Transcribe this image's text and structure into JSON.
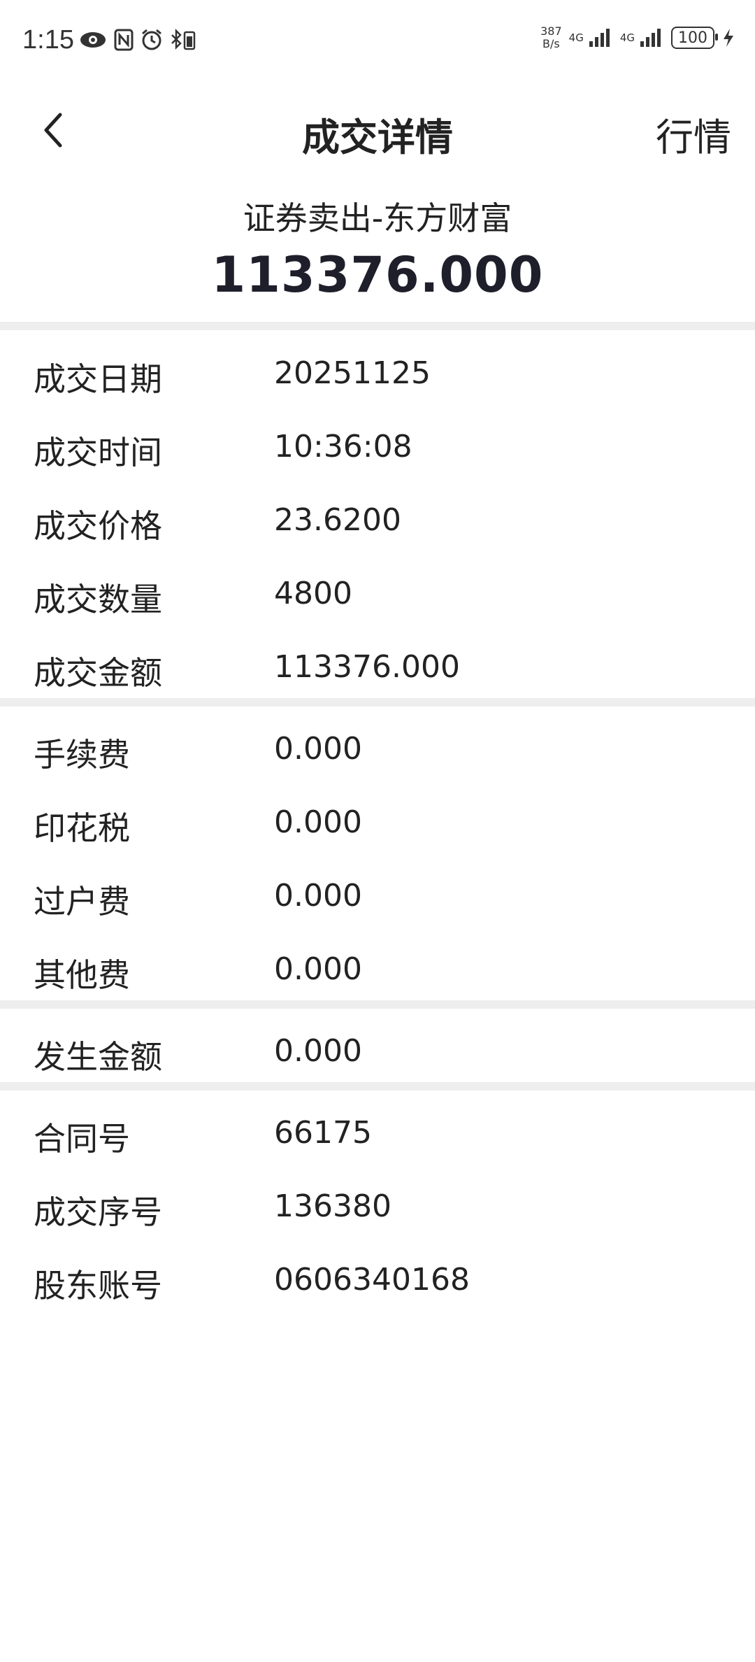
{
  "status_bar": {
    "time": "1:15",
    "net_speed_value": "387",
    "net_speed_unit": "B/s",
    "network1": "4G",
    "network2": "4G",
    "battery": "100",
    "icons": [
      "eye-icon",
      "nfc-icon",
      "alarm-icon",
      "bluetooth-battery-icon",
      "signal-icon",
      "charging-icon"
    ]
  },
  "nav": {
    "title": "成交详情",
    "right_label": "行情",
    "back_icon": "chevron-left-icon"
  },
  "summary": {
    "title": "证券卖出-东方财富",
    "amount": "113376.000"
  },
  "sections": [
    {
      "rows": [
        {
          "label": "成交日期",
          "value": "20251125"
        },
        {
          "label": "成交时间",
          "value": "10:36:08"
        },
        {
          "label": "成交价格",
          "value": "23.6200"
        },
        {
          "label": "成交数量",
          "value": "4800"
        },
        {
          "label": "成交金额",
          "value": "113376.000"
        }
      ]
    },
    {
      "rows": [
        {
          "label": "手续费",
          "value": "0.000"
        },
        {
          "label": "印花税",
          "value": "0.000"
        },
        {
          "label": "过户费",
          "value": "0.000"
        },
        {
          "label": "其他费",
          "value": "0.000"
        }
      ]
    },
    {
      "rows": [
        {
          "label": "发生金额",
          "value": "0.000"
        }
      ]
    },
    {
      "rows": [
        {
          "label": "合同号",
          "value": "66175"
        },
        {
          "label": "成交序号",
          "value": "136380"
        },
        {
          "label": "股东账号",
          "value": "0606340168"
        }
      ]
    }
  ],
  "colors": {
    "background": "#ffffff",
    "divider": "#eeeeef",
    "text": "#222222"
  }
}
